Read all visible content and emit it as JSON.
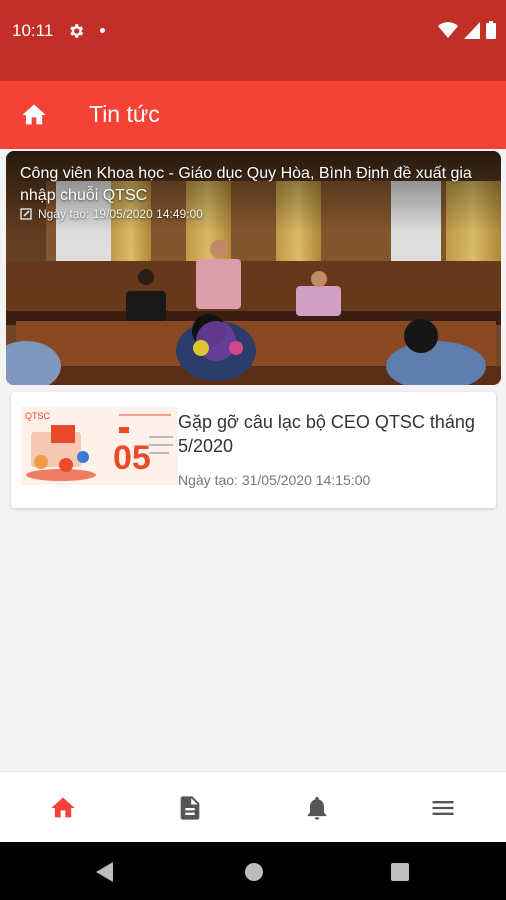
{
  "status_bar": {
    "time": "10:11"
  },
  "app_bar": {
    "title": "Tin tức"
  },
  "featured": {
    "title": "Công viên Khoa học - Giáo dục Quy Hòa, Bình Định đề xuất gia nhập chuỗi QTSC",
    "date": "Ngày tạo: 19/05/2020  14:49:00"
  },
  "news": [
    {
      "title": "Gặp gỡ câu lạc bộ CEO QTSC tháng 5/2020",
      "date": "Ngày tạo: 31/05/2020  14:15:00",
      "thumb_brand": "QTSC",
      "thumb_number": "05"
    }
  ],
  "colors": {
    "status_bar": "#c22f29",
    "app_bar": "#f44336",
    "accent": "#f44336",
    "nav_icon": "#555555"
  },
  "bottom_nav": [
    "home-icon",
    "document-icon",
    "bell-icon",
    "menu-icon"
  ]
}
